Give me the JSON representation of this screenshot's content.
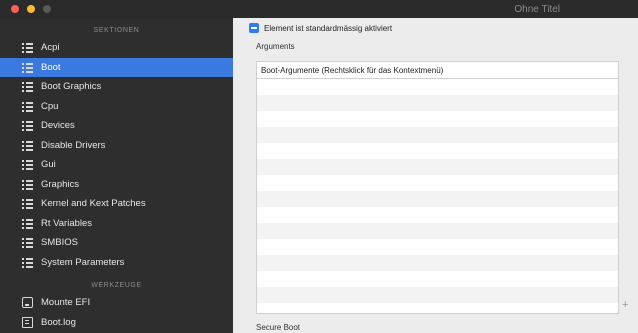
{
  "window": {
    "title": "Ohne Titel"
  },
  "sidebar": {
    "sections_header": "SEKTIONEN",
    "items": [
      {
        "label": "Acpi",
        "icon": "list-icon"
      },
      {
        "label": "Boot",
        "icon": "list-icon",
        "selected": true
      },
      {
        "label": "Boot Graphics",
        "icon": "list-icon"
      },
      {
        "label": "Cpu",
        "icon": "list-icon"
      },
      {
        "label": "Devices",
        "icon": "list-icon"
      },
      {
        "label": "Disable Drivers",
        "icon": "list-icon"
      },
      {
        "label": "Gui",
        "icon": "list-icon"
      },
      {
        "label": "Graphics",
        "icon": "list-icon"
      },
      {
        "label": "Kernel and Kext Patches",
        "icon": "list-icon"
      },
      {
        "label": "Rt Variables",
        "icon": "list-icon"
      },
      {
        "label": "SMBIOS",
        "icon": "list-icon"
      },
      {
        "label": "System Parameters",
        "icon": "list-icon"
      }
    ],
    "tools_header": "WERKZEUGE",
    "tools": [
      {
        "label": "Mounte EFI",
        "icon": "disk-icon"
      },
      {
        "label": "Boot.log",
        "icon": "document-icon"
      }
    ]
  },
  "main": {
    "checkbox_label": "Element ist standardmässig aktiviert",
    "checkbox_checked": true,
    "arguments_label": "Arguments",
    "table_header": "Boot-Argumente (Rechtsklick für das Kontextmenü)",
    "add_button": "+",
    "footer_label": "Secure Boot"
  },
  "colors": {
    "accent": "#3a79e0",
    "sidebar_bg": "#2e2e2e",
    "main_bg": "#ececec"
  }
}
